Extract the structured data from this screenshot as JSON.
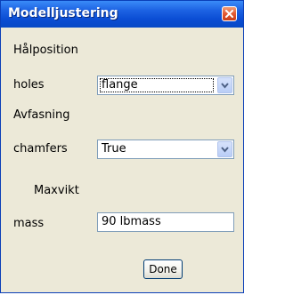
{
  "window": {
    "title": "Modelljustering"
  },
  "sections": [
    {
      "heading": "Hålposition",
      "field_label": "holes",
      "control": "combobox",
      "value": "flange"
    },
    {
      "heading": "Avfasning",
      "field_label": "chamfers",
      "control": "combobox",
      "value": "True"
    },
    {
      "heading": "Maxvikt",
      "field_label": "mass",
      "control": "textfield",
      "value": "90 lbmass"
    }
  ],
  "footer": {
    "done_label": "Done"
  },
  "icons": {
    "close": "close-icon",
    "dropdown": "chevron-down-icon"
  },
  "colors": {
    "titlebar": "#0a4cd3",
    "close_button": "#e35a32",
    "dialog_background": "#ece9d8",
    "field_border": "#7f9db9"
  }
}
